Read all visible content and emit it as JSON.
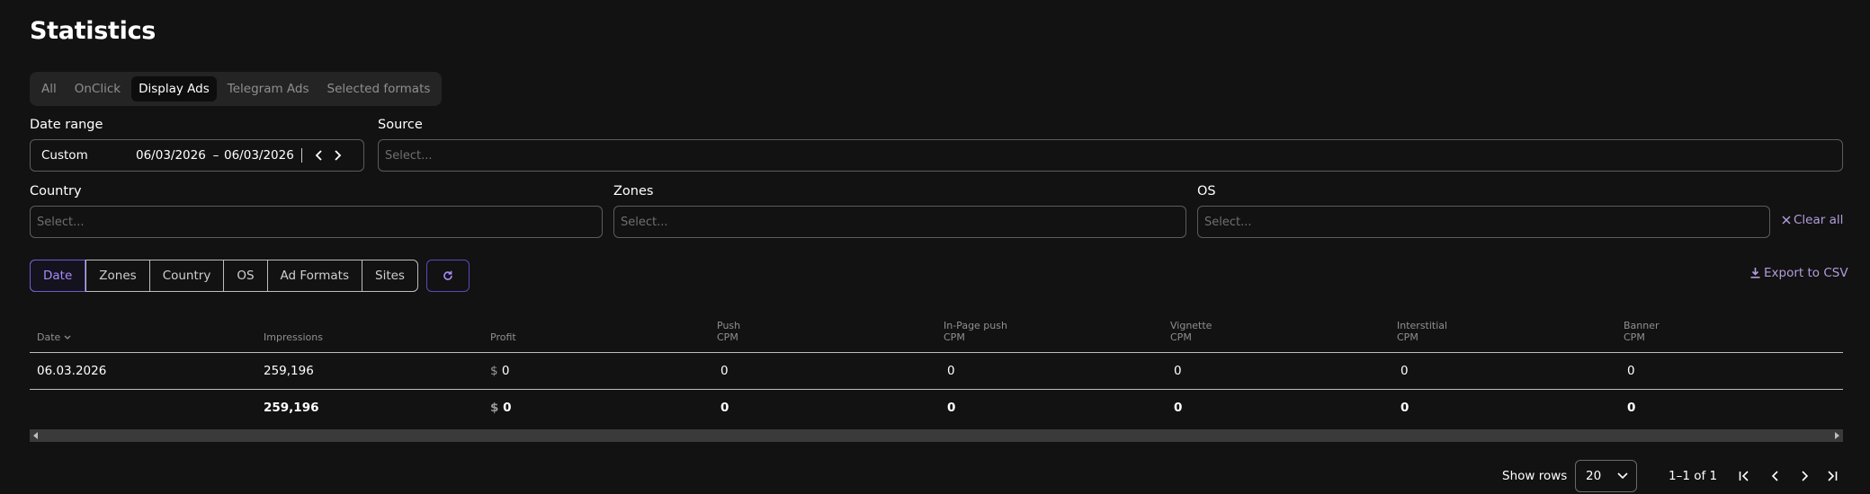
{
  "page": {
    "title": "Statistics"
  },
  "format_tabs": [
    {
      "label": "All",
      "active": false
    },
    {
      "label": "OnClick",
      "active": false
    },
    {
      "label": "Display Ads",
      "active": true
    },
    {
      "label": "Telegram Ads",
      "active": false
    },
    {
      "label": "Selected formats",
      "active": false
    }
  ],
  "filters": {
    "date_range": {
      "label": "Date range",
      "preset": "Custom",
      "start": "06/03/2026",
      "separator": "–",
      "end": "06/03/2026"
    },
    "source": {
      "label": "Source",
      "placeholder": "Select..."
    },
    "country": {
      "label": "Country",
      "placeholder": "Select..."
    },
    "zones": {
      "label": "Zones",
      "placeholder": "Select..."
    },
    "os": {
      "label": "OS",
      "placeholder": "Select..."
    },
    "clear_all": "Clear all"
  },
  "group_by": [
    {
      "label": "Date",
      "active": true
    },
    {
      "label": "Zones",
      "active": false
    },
    {
      "label": "Country",
      "active": false
    },
    {
      "label": "OS",
      "active": false
    },
    {
      "label": "Ad Formats",
      "active": false
    },
    {
      "label": "Sites",
      "active": false
    }
  ],
  "export_label": "Export to CSV",
  "table": {
    "headers": [
      {
        "line1": "Date",
        "line2": ""
      },
      {
        "line1": "Impressions",
        "line2": ""
      },
      {
        "line1": "Profit",
        "line2": ""
      },
      {
        "line1": "Push",
        "line2": "CPM"
      },
      {
        "line1": "In-Page push",
        "line2": "CPM"
      },
      {
        "line1": "Vignette",
        "line2": "CPM"
      },
      {
        "line1": "Interstitial",
        "line2": "CPM"
      },
      {
        "line1": "Banner",
        "line2": "CPM"
      }
    ],
    "currency_symbol": "$",
    "rows": [
      {
        "date": "06.03.2026",
        "impressions": "259,196",
        "profit": "0",
        "push_cpm": "0",
        "inpage_push_cpm": "0",
        "vignette_cpm": "0",
        "interstitial_cpm": "0",
        "banner_cpm": "0"
      }
    ],
    "totals": {
      "date": "",
      "impressions": "259,196",
      "profit": "0",
      "push_cpm": "0",
      "inpage_push_cpm": "0",
      "vignette_cpm": "0",
      "interstitial_cpm": "0",
      "banner_cpm": "0"
    }
  },
  "pagination": {
    "show_rows_label": "Show rows",
    "rows_per_page": "20",
    "range_text": "1–1 of 1"
  },
  "colors": {
    "background": "#121212",
    "accent": "#a78bfa",
    "link": "#b39ddb",
    "muted_text": "#8f8f8f"
  },
  "icons": {
    "sort": "chevron-down-icon",
    "refresh": "refresh-icon",
    "export": "download-icon",
    "clear": "close-icon",
    "pagination": [
      "first-page-icon",
      "previous-page-icon",
      "next-page-icon",
      "last-page-icon"
    ]
  }
}
